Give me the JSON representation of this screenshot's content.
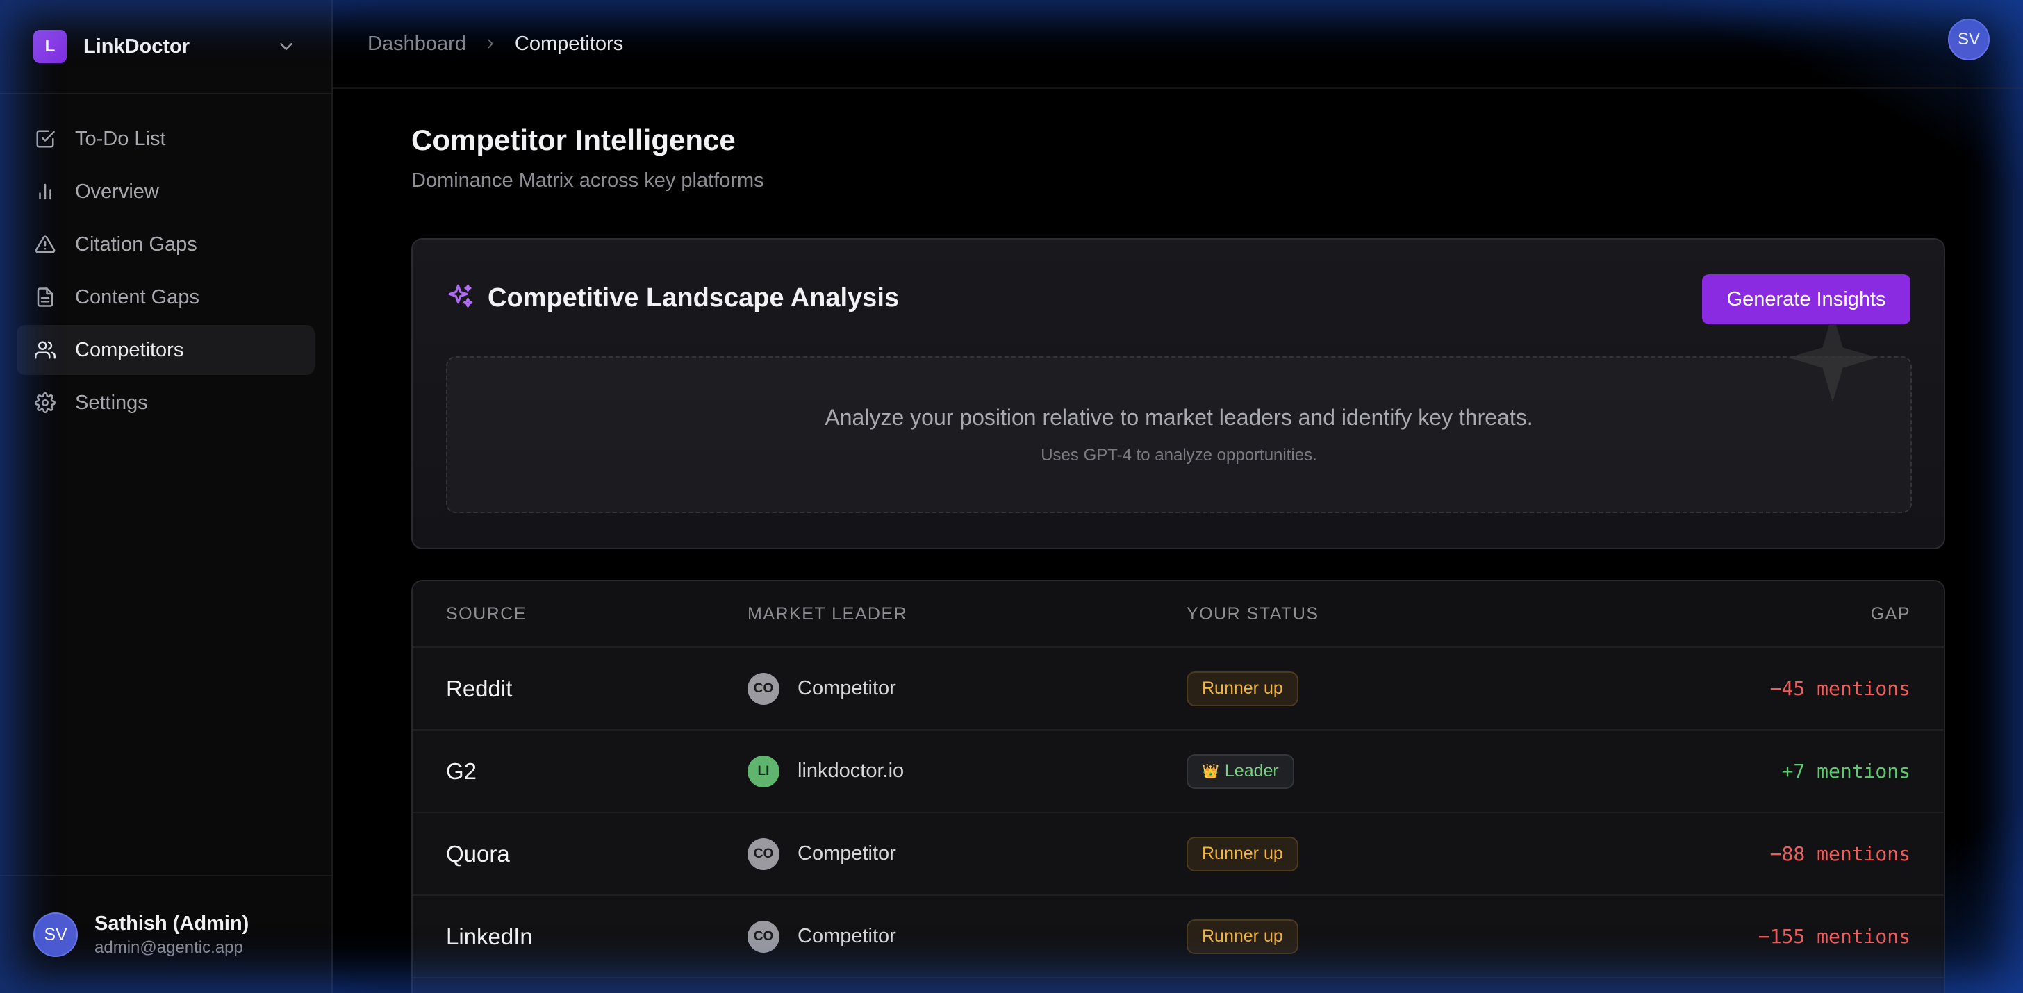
{
  "app": {
    "name": "LinkDoctor",
    "logo_letter": "L"
  },
  "sidebar": {
    "items": [
      {
        "label": "To-Do List",
        "icon": "checkbox-icon"
      },
      {
        "label": "Overview",
        "icon": "bar-chart-icon"
      },
      {
        "label": "Citation Gaps",
        "icon": "warning-icon"
      },
      {
        "label": "Content Gaps",
        "icon": "document-icon"
      },
      {
        "label": "Competitors",
        "icon": "users-icon",
        "active": true
      },
      {
        "label": "Settings",
        "icon": "gear-icon"
      }
    ]
  },
  "user": {
    "initials": "SV",
    "name": "Sathish (Admin)",
    "email": "admin@agentic.app"
  },
  "breadcrumb": {
    "parent": "Dashboard",
    "current": "Competitors"
  },
  "page": {
    "title": "Competitor Intelligence",
    "subtitle": "Dominance Matrix across key platforms"
  },
  "analysis_card": {
    "title": "Competitive Landscape Analysis",
    "button": "Generate Insights",
    "message": "Analyze your position relative to market leaders and identify key threats.",
    "note": "Uses GPT-4 to analyze opportunities."
  },
  "table": {
    "headers": {
      "source": "SOURCE",
      "leader": "MARKET LEADER",
      "status": "YOUR STATUS",
      "gap": "GAP"
    },
    "rows": [
      {
        "source": "Reddit",
        "leader_initials": "CO",
        "leader": "Competitor",
        "status": "Runner up",
        "gap": "−45 mentions"
      },
      {
        "source": "G2",
        "leader_initials": "LI",
        "leader": "linkdoctor.io",
        "status": "Leader",
        "status_emoji": "👑",
        "gap": "+7 mentions"
      },
      {
        "source": "Quora",
        "leader_initials": "CO",
        "leader": "Competitor",
        "status": "Runner up",
        "gap": "−88 mentions"
      },
      {
        "source": "LinkedIn",
        "leader_initials": "CO",
        "leader": "Competitor",
        "status": "Runner up",
        "gap": "−155 mentions"
      }
    ]
  },
  "colors": {
    "accent": "#8a2be2",
    "negative": "#f05d5d",
    "positive": "#5fc872",
    "runner_up": "#f1b640"
  }
}
